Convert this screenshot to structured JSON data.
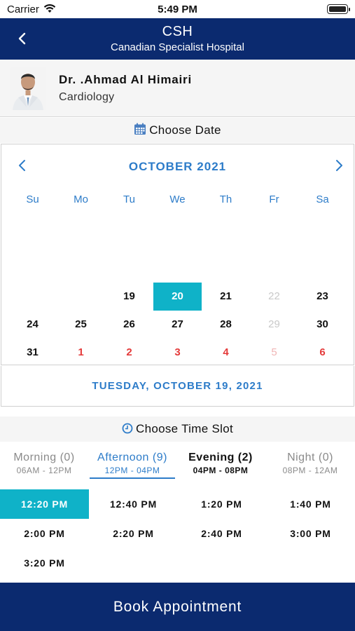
{
  "status_bar": {
    "carrier": "Carrier",
    "time": "5:49 PM"
  },
  "header": {
    "title": "CSH",
    "subtitle": "Canadian Specialist Hospital"
  },
  "doctor": {
    "name": "Dr. .Ahmad Al Himairi",
    "specialty": "Cardiology"
  },
  "date_section": {
    "title": "Choose Date",
    "month_label": "OCTOBER 2021",
    "weekdays": [
      "Su",
      "Mo",
      "Tu",
      "We",
      "Th",
      "Fr",
      "Sa"
    ],
    "week1": [
      "19",
      "20",
      "21",
      "22",
      "23"
    ],
    "week2": [
      "24",
      "25",
      "26",
      "27",
      "28",
      "29",
      "30"
    ],
    "week3": [
      "31",
      "1",
      "2",
      "3",
      "4",
      "5",
      "6"
    ],
    "selected_date_text": "TUESDAY, OCTOBER 19, 2021"
  },
  "time_section": {
    "title": "Choose Time Slot",
    "tabs": [
      {
        "label": "Morning (0)",
        "range": "06AM - 12PM"
      },
      {
        "label": "Afternoon (9)",
        "range": "12PM - 04PM"
      },
      {
        "label": "Evening (2)",
        "range": "04PM - 08PM"
      },
      {
        "label": "Night (0)",
        "range": "08PM - 12AM"
      }
    ],
    "slots": [
      "12:20 PM",
      "12:40 PM",
      "1:20 PM",
      "1:40 PM",
      "2:00 PM",
      "2:20 PM",
      "2:40 PM",
      "3:00 PM",
      "3:20 PM"
    ]
  },
  "book_label": "Book Appointment",
  "colors": {
    "navy": "#0b2a6f",
    "accent_blue": "#2d7cc9",
    "teal_selected": "#0fb2c8",
    "sunday_next_month_red": "#e43a3a"
  }
}
